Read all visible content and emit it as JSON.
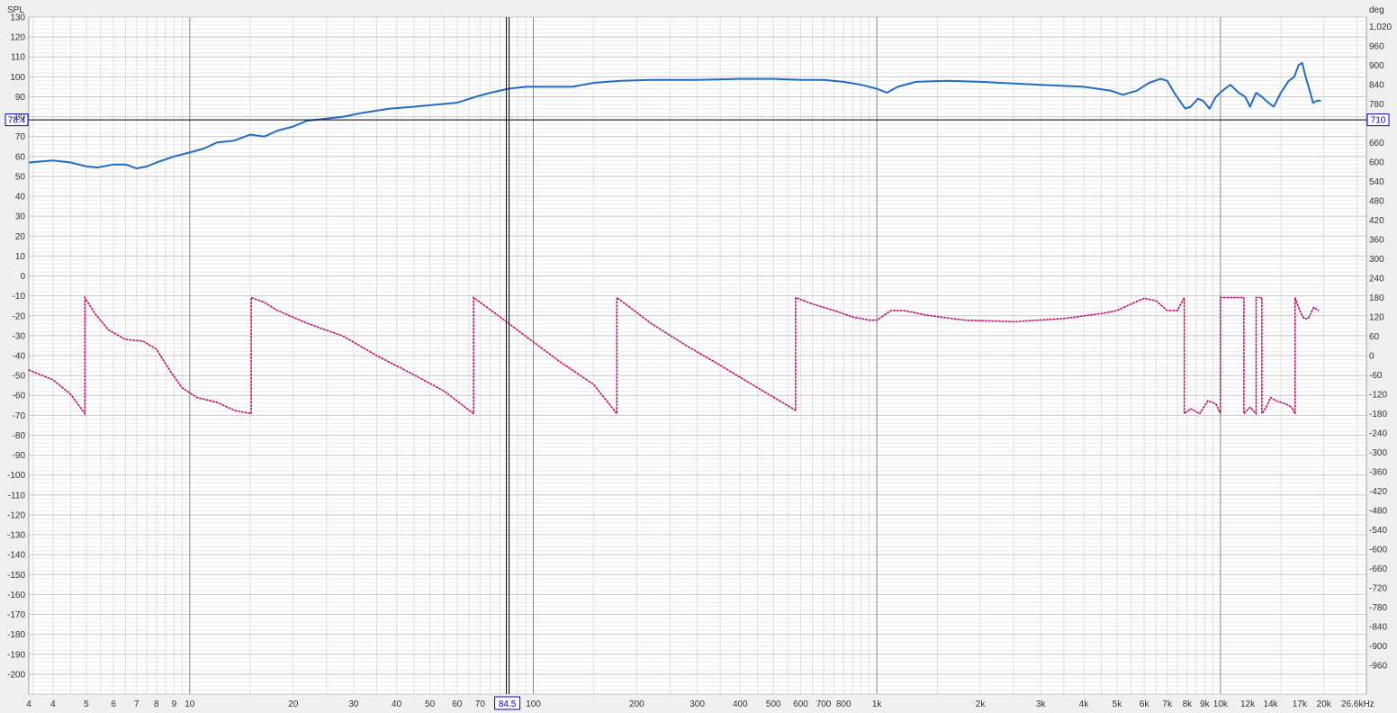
{
  "chart_data": {
    "type": "line",
    "x_axis": {
      "scale": "log",
      "range": [
        3.4,
        26600
      ],
      "unit_label": "26.6kHz",
      "tick_labels": [
        {
          "value": 3.4,
          "label": "4"
        },
        {
          "value": 4,
          "label": "4"
        },
        {
          "value": 5,
          "label": "5"
        },
        {
          "value": 6,
          "label": "6"
        },
        {
          "value": 7,
          "label": "7"
        },
        {
          "value": 8,
          "label": "8"
        },
        {
          "value": 9,
          "label": "9"
        },
        {
          "value": 10,
          "label": "10"
        },
        {
          "value": 20,
          "label": "20"
        },
        {
          "value": 30,
          "label": "30"
        },
        {
          "value": 40,
          "label": "40"
        },
        {
          "value": 50,
          "label": "50"
        },
        {
          "value": 60,
          "label": "60"
        },
        {
          "value": 70,
          "label": "70"
        },
        {
          "value": 100,
          "label": "100"
        },
        {
          "value": 200,
          "label": "200"
        },
        {
          "value": 300,
          "label": "300"
        },
        {
          "value": 400,
          "label": "400"
        },
        {
          "value": 500,
          "label": "500"
        },
        {
          "value": 600,
          "label": "600"
        },
        {
          "value": 700,
          "label": "700"
        },
        {
          "value": 800,
          "label": "800"
        },
        {
          "value": 1000,
          "label": "1k"
        },
        {
          "value": 2000,
          "label": "2k"
        },
        {
          "value": 3000,
          "label": "3k"
        },
        {
          "value": 4000,
          "label": "4k"
        },
        {
          "value": 5000,
          "label": "5k"
        },
        {
          "value": 6000,
          "label": "6k"
        },
        {
          "value": 7000,
          "label": "7k"
        },
        {
          "value": 8000,
          "label": "8k"
        },
        {
          "value": 9000,
          "label": "9k"
        },
        {
          "value": 10000,
          "label": "10k"
        },
        {
          "value": 12000,
          "label": "12k"
        },
        {
          "value": 14000,
          "label": "14k"
        },
        {
          "value": 17000,
          "label": "17k"
        },
        {
          "value": 20000,
          "label": "20k"
        }
      ]
    },
    "y_left": {
      "label": "SPL",
      "range": [
        -210,
        130
      ],
      "ticks": [
        130,
        120,
        110,
        100,
        90,
        80,
        70,
        60,
        50,
        40,
        30,
        20,
        10,
        0,
        -10,
        -20,
        -30,
        -40,
        -50,
        -60,
        -70,
        -80,
        -90,
        -100,
        -110,
        -120,
        -130,
        -140,
        -150,
        -160,
        -170,
        -180,
        -190,
        -200
      ]
    },
    "y_right": {
      "label": "deg",
      "range": [
        -1050,
        1050
      ],
      "ticks": [
        {
          "value": 1020,
          "label": "1,020"
        },
        {
          "value": 960,
          "label": "960"
        },
        {
          "value": 900,
          "label": "900"
        },
        {
          "value": 840,
          "label": "840"
        },
        {
          "value": 780,
          "label": "780"
        },
        {
          "value": 660,
          "label": "660"
        },
        {
          "value": 600,
          "label": "600"
        },
        {
          "value": 540,
          "label": "540"
        },
        {
          "value": 480,
          "label": "480"
        },
        {
          "value": 420,
          "label": "420"
        },
        {
          "value": 360,
          "label": "360"
        },
        {
          "value": 300,
          "label": "300"
        },
        {
          "value": 240,
          "label": "240"
        },
        {
          "value": 180,
          "label": "180"
        },
        {
          "value": 120,
          "label": "120"
        },
        {
          "value": 60,
          "label": "60"
        },
        {
          "value": 0,
          "label": "0"
        },
        {
          "value": -60,
          "label": "-60"
        },
        {
          "value": -120,
          "label": "-120"
        },
        {
          "value": -180,
          "label": "-180"
        },
        {
          "value": -240,
          "label": "-240"
        },
        {
          "value": -300,
          "label": "-300"
        },
        {
          "value": -360,
          "label": "-360"
        },
        {
          "value": -420,
          "label": "-420"
        },
        {
          "value": -480,
          "label": "-480"
        },
        {
          "value": -540,
          "label": "-540"
        },
        {
          "value": -600,
          "label": "-600"
        },
        {
          "value": -660,
          "label": "-660"
        },
        {
          "value": -720,
          "label": "-720"
        },
        {
          "value": -780,
          "label": "-780"
        },
        {
          "value": -840,
          "label": "-840"
        },
        {
          "value": -900,
          "label": "-900"
        },
        {
          "value": -960,
          "label": "-960"
        }
      ]
    },
    "cursor": {
      "x_value": 84.5,
      "x_label": "84.5",
      "y_value": 78.4,
      "y_label": "78.4",
      "phase_label": "710"
    },
    "grid": true,
    "colors": {
      "background": "#ffffff",
      "spl": "#1f6dc4",
      "phase": "#c0106e",
      "grid_minor": "#dcdcdc",
      "grid_major": "#8a8a8a",
      "cursor": "#000000",
      "cursor_label": "#0000cc"
    },
    "series": [
      {
        "axis": "left",
        "style": "solid",
        "points": [
          [
            3.4,
            57
          ],
          [
            4,
            58
          ],
          [
            4.5,
            57
          ],
          [
            5,
            55
          ],
          [
            5.4,
            54.5
          ],
          [
            6,
            56
          ],
          [
            6.5,
            56
          ],
          [
            7,
            54
          ],
          [
            7.5,
            55
          ],
          [
            8,
            57
          ],
          [
            9,
            60
          ],
          [
            10,
            62
          ],
          [
            11,
            64
          ],
          [
            12,
            67
          ],
          [
            13.5,
            68
          ],
          [
            15,
            71
          ],
          [
            16.5,
            70
          ],
          [
            18,
            73
          ],
          [
            20,
            75
          ],
          [
            22,
            78
          ],
          [
            25,
            79
          ],
          [
            28,
            80
          ],
          [
            32,
            82
          ],
          [
            38,
            84
          ],
          [
            45,
            85
          ],
          [
            52,
            86
          ],
          [
            60,
            87
          ],
          [
            68,
            90
          ],
          [
            75,
            92
          ],
          [
            84.5,
            94
          ],
          [
            95,
            95
          ],
          [
            110,
            95
          ],
          [
            130,
            95
          ],
          [
            150,
            97
          ],
          [
            180,
            98
          ],
          [
            220,
            98.5
          ],
          [
            300,
            98.5
          ],
          [
            400,
            99
          ],
          [
            500,
            99
          ],
          [
            600,
            98.5
          ],
          [
            700,
            98.5
          ],
          [
            800,
            97.5
          ],
          [
            900,
            96
          ],
          [
            1000,
            94
          ],
          [
            1070,
            92
          ],
          [
            1150,
            95
          ],
          [
            1300,
            97.5
          ],
          [
            1600,
            98
          ],
          [
            2000,
            97.5
          ],
          [
            3000,
            96
          ],
          [
            4000,
            95
          ],
          [
            4800,
            93
          ],
          [
            5200,
            91
          ],
          [
            5700,
            93
          ],
          [
            6200,
            97
          ],
          [
            6700,
            99
          ],
          [
            7000,
            98
          ],
          [
            7400,
            91
          ],
          [
            7900,
            84
          ],
          [
            8200,
            85
          ],
          [
            8600,
            89
          ],
          [
            8900,
            88
          ],
          [
            9300,
            84
          ],
          [
            9700,
            90
          ],
          [
            10300,
            94
          ],
          [
            10700,
            96
          ],
          [
            11300,
            92
          ],
          [
            11800,
            90
          ],
          [
            12200,
            85
          ],
          [
            12700,
            92
          ],
          [
            13200,
            90
          ],
          [
            13800,
            87
          ],
          [
            14300,
            85
          ],
          [
            15000,
            92
          ],
          [
            15800,
            98
          ],
          [
            16400,
            100
          ],
          [
            16900,
            106
          ],
          [
            17300,
            107
          ],
          [
            17700,
            100
          ],
          [
            18200,
            93
          ],
          [
            18600,
            87
          ],
          [
            19100,
            88
          ],
          [
            19600,
            88
          ]
        ]
      },
      {
        "axis": "right",
        "style": "dotted",
        "points": [
          [
            3.4,
            -45
          ],
          [
            4,
            -75
          ],
          [
            4.5,
            -120
          ],
          [
            4.95,
            -180
          ],
          [
            4.95,
            180
          ],
          [
            5.3,
            130
          ],
          [
            5.8,
            80
          ],
          [
            6.5,
            50
          ],
          [
            7.3,
            45
          ],
          [
            8,
            20
          ],
          [
            8.8,
            -50
          ],
          [
            9.5,
            -100
          ],
          [
            10.5,
            -130
          ],
          [
            12,
            -145
          ],
          [
            13.5,
            -170
          ],
          [
            15.1,
            -180
          ],
          [
            15.1,
            180
          ],
          [
            16.5,
            165
          ],
          [
            18,
            140
          ],
          [
            22,
            100
          ],
          [
            28,
            60
          ],
          [
            35,
            0
          ],
          [
            45,
            -60
          ],
          [
            55,
            -110
          ],
          [
            67,
            -180
          ],
          [
            67,
            180
          ],
          [
            80,
            120
          ],
          [
            95,
            60
          ],
          [
            120,
            -20
          ],
          [
            150,
            -90
          ],
          [
            175,
            -180
          ],
          [
            175,
            180
          ],
          [
            220,
            100
          ],
          [
            280,
            30
          ],
          [
            350,
            -30
          ],
          [
            450,
            -100
          ],
          [
            560,
            -160
          ],
          [
            580,
            -170
          ],
          [
            580,
            180
          ],
          [
            650,
            160
          ],
          [
            750,
            140
          ],
          [
            850,
            120
          ],
          [
            950,
            110
          ],
          [
            1000,
            110
          ],
          [
            1100,
            140
          ],
          [
            1200,
            140
          ],
          [
            1400,
            125
          ],
          [
            1800,
            110
          ],
          [
            2500,
            105
          ],
          [
            3500,
            115
          ],
          [
            4500,
            130
          ],
          [
            5000,
            140
          ],
          [
            5500,
            160
          ],
          [
            6000,
            178
          ],
          [
            6500,
            170
          ],
          [
            7000,
            140
          ],
          [
            7500,
            140
          ],
          [
            7850,
            180
          ],
          [
            7850,
            -180
          ],
          [
            8200,
            -165
          ],
          [
            8700,
            -180
          ],
          [
            9200,
            -140
          ],
          [
            9700,
            -150
          ],
          [
            10000,
            -180
          ],
          [
            10000,
            180
          ],
          [
            11200,
            180
          ],
          [
            11700,
            180
          ],
          [
            11700,
            -180
          ],
          [
            12200,
            -160
          ],
          [
            12700,
            -180
          ],
          [
            12700,
            180
          ],
          [
            13000,
            180
          ],
          [
            13200,
            180
          ],
          [
            13200,
            -180
          ],
          [
            13600,
            -160
          ],
          [
            14000,
            -130
          ],
          [
            14500,
            -140
          ],
          [
            15500,
            -150
          ],
          [
            16100,
            -160
          ],
          [
            16500,
            -180
          ],
          [
            16500,
            180
          ],
          [
            17000,
            140
          ],
          [
            17500,
            115
          ],
          [
            18000,
            115
          ],
          [
            18700,
            150
          ],
          [
            19300,
            140
          ]
        ]
      }
    ]
  }
}
